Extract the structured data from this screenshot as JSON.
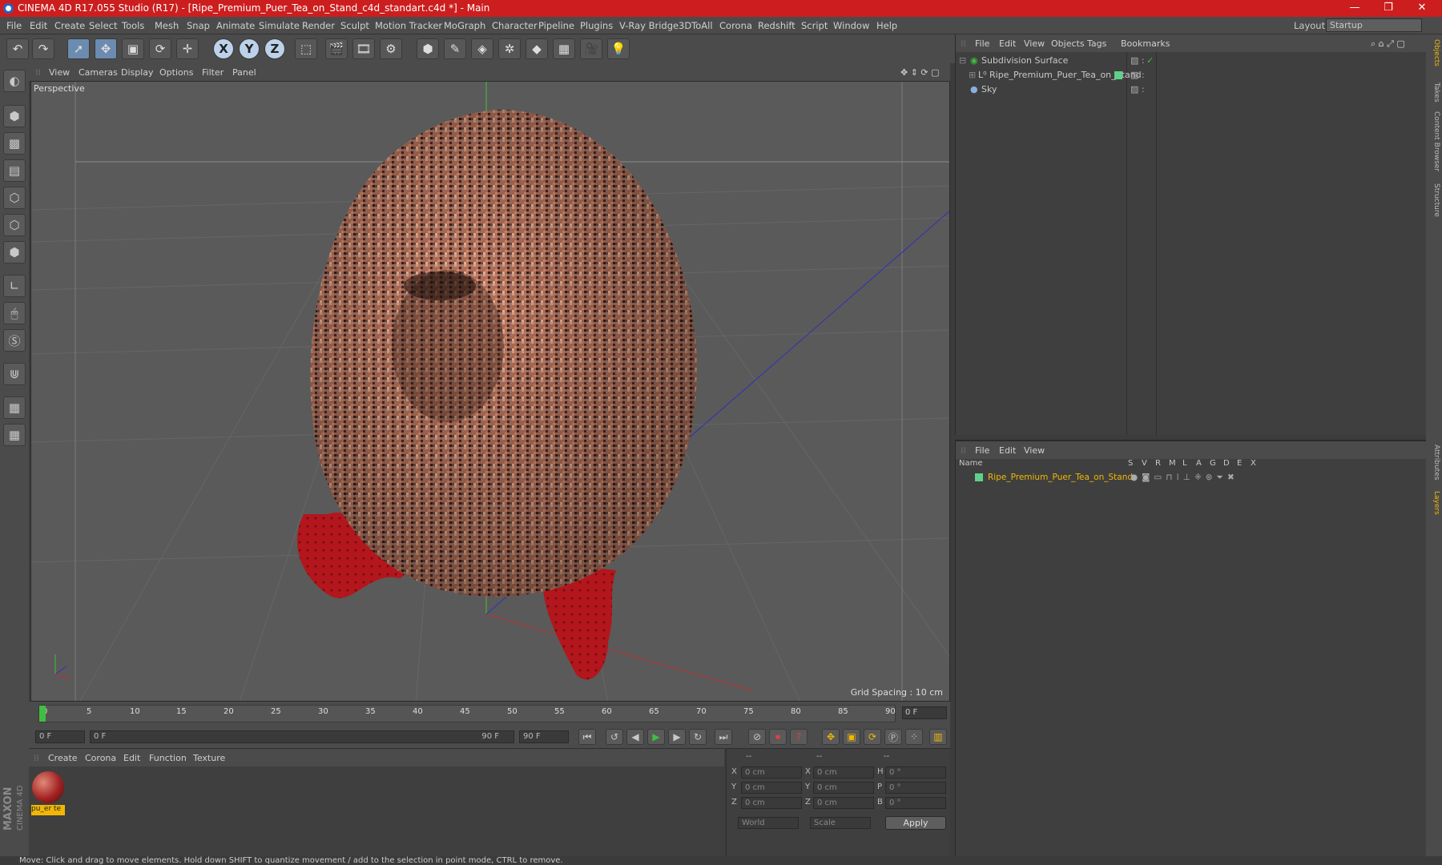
{
  "titlebar": {
    "title": "CINEMA 4D R17.055 Studio (R17) - [Ripe_Premium_Puer_Tea_on_Stand_c4d_standart.c4d *] - Main",
    "minimize": "—",
    "maximize": "❐",
    "close": "✕"
  },
  "menubar": {
    "items": [
      "File",
      "Edit",
      "Create",
      "Select",
      "Tools",
      "Mesh",
      "Snap",
      "Animate",
      "Simulate",
      "Render",
      "Sculpt",
      "Motion Tracker",
      "MoGraph",
      "Character",
      "Pipeline",
      "Plugins",
      "V-Ray Bridge",
      "3DToAll",
      "Corona",
      "Redshift",
      "Script",
      "Window",
      "Help"
    ],
    "layout_label": "Layout:",
    "layout_value": "Startup"
  },
  "viewport": {
    "menu": [
      "View",
      "Cameras",
      "Display",
      "Options",
      "Filter",
      "Panel"
    ],
    "camera": "Perspective",
    "grid_spacing": "Grid Spacing : 10 cm"
  },
  "timeline": {
    "ticks": [
      "0",
      "5",
      "10",
      "15",
      "20",
      "25",
      "30",
      "35",
      "40",
      "45",
      "50",
      "55",
      "60",
      "65",
      "70",
      "75",
      "80",
      "85",
      "90"
    ],
    "current_frame": "0 F"
  },
  "transport": {
    "start": "0 F",
    "range_start": "0 F",
    "range_end": "90 F",
    "end": "90 F"
  },
  "material_panel": {
    "menu": [
      "Create",
      "Corona",
      "Edit",
      "Function",
      "Texture"
    ],
    "material_name": "pu_er te"
  },
  "coords": {
    "header": [
      "--",
      "--",
      "--"
    ],
    "rows": [
      {
        "a": "X",
        "av": "0 cm",
        "b": "X",
        "bv": "0 cm",
        "c": "H",
        "cv": "0 °"
      },
      {
        "a": "Y",
        "av": "0 cm",
        "b": "Y",
        "bv": "0 cm",
        "c": "P",
        "cv": "0 °"
      },
      {
        "a": "Z",
        "av": "0 cm",
        "b": "Z",
        "bv": "0 cm",
        "c": "B",
        "cv": "0 °"
      }
    ],
    "world": "World",
    "scale": "Scale",
    "apply": "Apply"
  },
  "object_manager": {
    "menu": [
      "File",
      "Edit",
      "View",
      "Objects",
      "Tags",
      "Bookmarks"
    ],
    "objects": [
      "Subdivision Surface",
      "Ripe_Premium_Puer_Tea_on_Stand",
      "Sky"
    ]
  },
  "layers": {
    "menu": [
      "File",
      "Edit",
      "View"
    ],
    "columns": [
      "Name",
      "S",
      "V",
      "R",
      "M",
      "L",
      "A",
      "G",
      "D",
      "E",
      "X"
    ],
    "row_name": "Ripe_Premium_Puer_Tea_on_Stand"
  },
  "right_tabs": [
    "Objects",
    "Takes",
    "Content Browser",
    "Structure",
    "Attributes",
    "Layers"
  ],
  "statusbar": {
    "text": "Move: Click and drag to move elements. Hold down SHIFT to quantize movement / add to the selection in point mode, CTRL to remove."
  },
  "brand": {
    "text": "MAXON CINEMA 4D"
  },
  "colors": {
    "title_red": "#cc1e1e",
    "accent_orange": "#f2b705",
    "layer_green": "#5fd08a",
    "stand_red": "#b3161c"
  }
}
